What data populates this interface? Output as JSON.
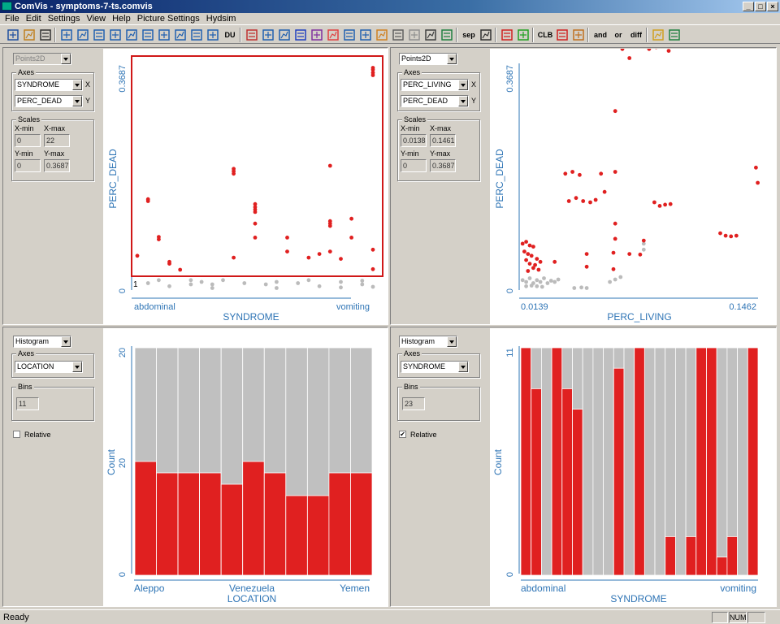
{
  "window": {
    "title": "ComVis - symptoms-7-ts.comvis",
    "btn_min": "_",
    "btn_max": "□",
    "btn_close": "×"
  },
  "menu": [
    "File",
    "Edit",
    "Settings",
    "View",
    "Help",
    "Picture Settings",
    "Hydsim"
  ],
  "toolbar": {
    "text_buttons": {
      "sep": "sep",
      "clb": "CLB",
      "and": "and",
      "or": "or",
      "diff": "diff",
      "du": "DU"
    },
    "icons": [
      "new-icon",
      "open-icon",
      "save-icon",
      "layout-1-icon",
      "layout-2-icon",
      "layout-3-icon",
      "layout-4-icon",
      "layout-5-icon",
      "layout-6-icon",
      "layout-7-icon",
      "layout-8-icon",
      "layout-9-icon",
      "layout-10-icon",
      "du-icon",
      "brush-icon",
      "scatter-icon",
      "axes-icon",
      "bar-chart-icon",
      "parallel-coords-icon",
      "pie-icon",
      "histogram-icon",
      "timeseries-icon",
      "curve-icon",
      "circle-icon",
      "star-icon",
      "surface-icon",
      "map-icon",
      "sep-icon",
      "hammer-icon",
      "linked-views-icon",
      "nodes-icon",
      "clb-icon",
      "delete-icon",
      "paint-icon",
      "and-icon",
      "or-icon",
      "diff-icon",
      "folder-icon",
      "notes-icon"
    ]
  },
  "views": [
    {
      "id": "top-left",
      "view_type": "Points2D",
      "axes_label": "Axes",
      "x_axis": "SYNDROME",
      "y_axis": "PERC_DEAD",
      "scales_label": "Scales",
      "xmin_label": "X-min",
      "xmax_label": "X-max",
      "ymin_label": "Y-min",
      "ymax_label": "Y-max",
      "xmin": "0",
      "xmax": "22",
      "ymin": "0",
      "ymax": "0.36873",
      "ytick_top": "0.3687",
      "ytick_bottom": "0",
      "xtick_left": "abdominal",
      "xtick_right": "vomiting",
      "brush_label": "1",
      "chart_data": {
        "type": "scatter",
        "xlabel": "SYNDROME",
        "ylabel": "PERC_DEAD",
        "xlim": [
          0,
          22
        ],
        "ylim": [
          0,
          0.3687
        ],
        "series": [
          {
            "name": "selected",
            "color": "#e02020",
            "points": [
              [
                0,
                0.055
              ],
              [
                1,
                0.145
              ],
              [
                1,
                0.148
              ],
              [
                2,
                0.082
              ],
              [
                2,
                0.086
              ],
              [
                3,
                0.045
              ],
              [
                3,
                0.042
              ],
              [
                4,
                0.032
              ],
              [
                9,
                0.052
              ],
              [
                9,
                0.198
              ],
              [
                9,
                0.194
              ],
              [
                9,
                0.19
              ],
              [
                11,
                0.14
              ],
              [
                11,
                0.135
              ],
              [
                11,
                0.131
              ],
              [
                11,
                0.127
              ],
              [
                11,
                0.108
              ],
              [
                11,
                0.085
              ],
              [
                14,
                0.085
              ],
              [
                14,
                0.062
              ],
              [
                16,
                0.052
              ],
              [
                17,
                0.058
              ],
              [
                18,
                0.062
              ],
              [
                18,
                0.112
              ],
              [
                18,
                0.108
              ],
              [
                18,
                0.104
              ],
              [
                18,
                0.203
              ],
              [
                19,
                0.05
              ],
              [
                20,
                0.116
              ],
              [
                20,
                0.085
              ],
              [
                22,
                0.033
              ],
              [
                22,
                0.065
              ],
              [
                22,
                0.361
              ],
              [
                22,
                0.356
              ],
              [
                22,
                0.352
              ],
              [
                22,
                0.364
              ]
            ]
          },
          {
            "name": "unselected",
            "color": "#bbbbbb",
            "points": [
              [
                1,
                0.01
              ],
              [
                2,
                0.015
              ],
              [
                3,
                0.005
              ],
              [
                5,
                0.008
              ],
              [
                5,
                0.015
              ],
              [
                6,
                0.012
              ],
              [
                7,
                0.008
              ],
              [
                7,
                0.002
              ],
              [
                8,
                0.015
              ],
              [
                10,
                0.01
              ],
              [
                12,
                0.008
              ],
              [
                13,
                0.012
              ],
              [
                13,
                0.002
              ],
              [
                15,
                0.01
              ],
              [
                16,
                0.015
              ],
              [
                17,
                0.005
              ],
              [
                19,
                0.012
              ],
              [
                19,
                0.003
              ],
              [
                21,
                0.008
              ],
              [
                21,
                0.014
              ],
              [
                22,
                0.004
              ]
            ]
          }
        ]
      }
    },
    {
      "id": "top-right",
      "view_type": "Points2D",
      "axes_label": "Axes",
      "x_axis": "PERC_LIVING",
      "y_axis": "PERC_DEAD",
      "scales_label": "Scales",
      "xmin_label": "X-min",
      "xmax_label": "X-max",
      "ymin_label": "Y-min",
      "ymax_label": "Y-max",
      "xmin": "0.01388",
      "xmax": "0.14619",
      "ymin": "0",
      "ymax": "0.36873",
      "ytick_top": "0.3687",
      "ytick_bottom": "0",
      "xtick_left": "0.0139",
      "xtick_right": "0.1462",
      "chart_data": {
        "type": "scatter",
        "xlabel": "PERC_LIVING",
        "ylabel": "PERC_DEAD",
        "xlim": [
          0.0139,
          0.1462
        ],
        "ylim": [
          0,
          0.3687
        ],
        "series": [
          {
            "name": "selected",
            "color": "#e02020",
            "points": [
              [
                0.014,
                0.075
              ],
              [
                0.016,
                0.078
              ],
              [
                0.018,
                0.072
              ],
              [
                0.02,
                0.07
              ],
              [
                0.015,
                0.062
              ],
              [
                0.017,
                0.058
              ],
              [
                0.019,
                0.055
              ],
              [
                0.022,
                0.05
              ],
              [
                0.016,
                0.048
              ],
              [
                0.018,
                0.042
              ],
              [
                0.021,
                0.04
              ],
              [
                0.024,
                0.045
              ],
              [
                0.02,
                0.035
              ],
              [
                0.023,
                0.032
              ],
              [
                0.017,
                0.03
              ],
              [
                0.032,
                0.045
              ],
              [
                0.038,
                0.19
              ],
              [
                0.042,
                0.193
              ],
              [
                0.046,
                0.188
              ],
              [
                0.04,
                0.145
              ],
              [
                0.044,
                0.15
              ],
              [
                0.048,
                0.145
              ],
              [
                0.052,
                0.143
              ],
              [
                0.055,
                0.147
              ],
              [
                0.058,
                0.19
              ],
              [
                0.066,
                0.193
              ],
              [
                0.06,
                0.16
              ],
              [
                0.066,
                0.108
              ],
              [
                0.066,
                0.083
              ],
              [
                0.065,
                0.06
              ],
              [
                0.05,
                0.058
              ],
              [
                0.05,
                0.037
              ],
              [
                0.065,
                0.033
              ],
              [
                0.074,
                0.058
              ],
              [
                0.08,
                0.057
              ],
              [
                0.082,
                0.08
              ],
              [
                0.088,
                0.143
              ],
              [
                0.091,
                0.137
              ],
              [
                0.094,
                0.139
              ],
              [
                0.097,
                0.14
              ],
              [
                0.066,
                0.293
              ],
              [
                0.07,
                0.395
              ],
              [
                0.074,
                0.38
              ],
              [
                0.085,
                0.395
              ],
              [
                0.089,
                0.398
              ],
              [
                0.096,
                0.392
              ],
              [
                0.12,
                0.4
              ],
              [
                0.125,
                0.092
              ],
              [
                0.128,
                0.088
              ],
              [
                0.131,
                0.087
              ],
              [
                0.134,
                0.088
              ],
              [
                0.145,
                0.2
              ],
              [
                0.146,
                0.175
              ]
            ]
          },
          {
            "name": "unselected",
            "color": "#bbbbbb",
            "points": [
              [
                0.014,
                0.015
              ],
              [
                0.016,
                0.012
              ],
              [
                0.018,
                0.018
              ],
              [
                0.02,
                0.01
              ],
              [
                0.022,
                0.015
              ],
              [
                0.024,
                0.012
              ],
              [
                0.026,
                0.018
              ],
              [
                0.028,
                0.01
              ],
              [
                0.03,
                0.014
              ],
              [
                0.032,
                0.012
              ],
              [
                0.034,
                0.016
              ],
              [
                0.016,
                0.005
              ],
              [
                0.019,
                0.006
              ],
              [
                0.022,
                0.005
              ],
              [
                0.025,
                0.004
              ],
              [
                0.043,
                0.002
              ],
              [
                0.047,
                0.003
              ],
              [
                0.05,
                0.002
              ],
              [
                0.063,
                0.012
              ],
              [
                0.066,
                0.016
              ],
              [
                0.069,
                0.02
              ],
              [
                0.082,
                0.075
              ],
              [
                0.082,
                0.065
              ]
            ]
          }
        ]
      }
    },
    {
      "id": "bottom-left",
      "view_type": "Histogram",
      "axes_label": "Axes",
      "x_axis": "LOCATION",
      "bins_label": "Bins",
      "bins": "11",
      "relative_label": "Relative",
      "relative_checked": false,
      "ytick_top": "20",
      "ytick_mid": "20",
      "ytick_bottom": "0",
      "ylabel": "Count",
      "xtick_left": "Aleppo",
      "xtick_mid": "Venezuela",
      "xtick_right": "Yemen",
      "xlabel": "LOCATION",
      "chart_data": {
        "type": "bar",
        "xlabel": "LOCATION",
        "ylabel": "Count",
        "ylim": [
          0,
          40
        ],
        "series": [
          {
            "name": "total",
            "color": "#c0c0c0",
            "values": [
              40,
              40,
              40,
              40,
              40,
              40,
              40,
              40,
              40,
              40,
              40
            ]
          },
          {
            "name": "selected",
            "color": "#e02020",
            "values": [
              20,
              18,
              18,
              18,
              16,
              20,
              18,
              14,
              14,
              18,
              18
            ]
          }
        ]
      }
    },
    {
      "id": "bottom-right",
      "view_type": "Histogram",
      "axes_label": "Axes",
      "x_axis": "SYNDROME",
      "bins_label": "Bins",
      "bins": "23",
      "relative_label": "Relative",
      "relative_checked": true,
      "check_mark": "✔",
      "ytick_top": "11",
      "ytick_bottom": "0",
      "ylabel": "Count",
      "xtick_left": "abdominal",
      "xtick_right": "vomiting",
      "xlabel": "SYNDROME",
      "chart_data": {
        "type": "bar",
        "xlabel": "SYNDROME",
        "ylabel": "Count",
        "relative": true,
        "ylim": [
          0,
          1
        ],
        "series": [
          {
            "name": "total",
            "color": "#c0c0c0",
            "values": [
              1,
              1,
              1,
              1,
              1,
              1,
              1,
              1,
              1,
              1,
              1,
              1,
              1,
              1,
              1,
              1,
              1,
              1,
              1,
              1,
              1,
              1,
              1
            ]
          },
          {
            "name": "selected",
            "color": "#e02020",
            "values": [
              1,
              0.82,
              0,
              1,
              0.82,
              0.73,
              0,
              0,
              0,
              0.91,
              0,
              1,
              0,
              0,
              0.17,
              0,
              0.17,
              1,
              1,
              0.08,
              0.17,
              0,
              1
            ]
          }
        ]
      }
    }
  ],
  "status": {
    "text": "Ready",
    "num": "NUM"
  }
}
